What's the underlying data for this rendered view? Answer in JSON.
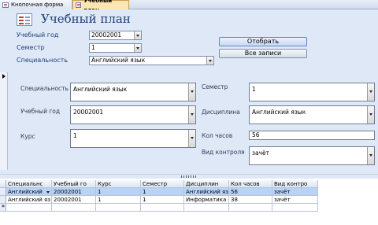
{
  "tabs": [
    {
      "label": "Кнопочная форма",
      "active": false
    },
    {
      "label": "Учебный план",
      "active": true
    }
  ],
  "header": {
    "title": "Учебный план",
    "year_label": "Учебный год",
    "year_value": "20002001",
    "semester_label": "Семестр",
    "semester_value": "1",
    "specialty_label": "Специальность",
    "specialty_value": "Английский язык",
    "select_button": "Отобрать",
    "all_records_button": "Все записи"
  },
  "detail": {
    "specialty_label": "Специальность",
    "specialty_value": "Английский язык",
    "year_label": "Учебный год",
    "year_value": "20002001",
    "course_label": "Курс",
    "course_value": "1",
    "semester_label": "Семестр",
    "semester_value": "1",
    "discipline_label": "Дисциплина",
    "discipline_value": "Английский язык",
    "hours_label": "Кол часов",
    "hours_value": "56",
    "control_label": "Вид контроля",
    "control_value": "зачёт"
  },
  "table": {
    "headers": [
      "Специальнс",
      "Учебный го",
      "Курс",
      "Семестр",
      "Дисциплин",
      "Кол часов",
      "Вид контро"
    ],
    "rows": [
      [
        "Английский",
        "20002001",
        "1",
        "1",
        "Английский яз",
        "56",
        "зачёт"
      ],
      [
        "Английский яз",
        "20002001",
        "1",
        "1",
        "Информатика",
        "38",
        "зачёт"
      ]
    ],
    "new_row_marker": "*"
  },
  "colors": {
    "section_bg": "#dfe8f6",
    "title_color": "#1f3f7a",
    "selected_row": "#b8d3f5",
    "active_tab": "#fbe6b3"
  }
}
